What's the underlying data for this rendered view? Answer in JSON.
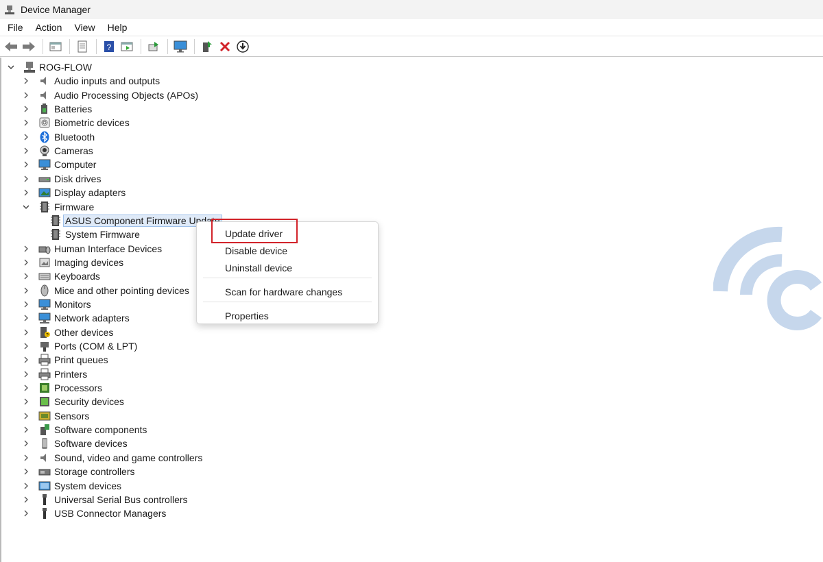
{
  "window": {
    "title": "Device Manager"
  },
  "menubar": {
    "items": [
      "File",
      "Action",
      "View",
      "Help"
    ]
  },
  "toolbar": {
    "icons": [
      "back-arrow-icon",
      "forward-arrow-icon",
      "show-hide-console-tree-icon",
      "properties-sheet-icon",
      "help-icon",
      "action-pane-icon",
      "scan-hardware-icon",
      "monitor-icon",
      "enable-device-icon",
      "uninstall-device-icon",
      "update-driver-icon"
    ]
  },
  "tree": {
    "root": "ROG-FLOW",
    "categories": [
      {
        "label": "Audio inputs and outputs",
        "icon": "speaker-icon",
        "expanded": false
      },
      {
        "label": "Audio Processing Objects (APOs)",
        "icon": "speaker-icon",
        "expanded": false
      },
      {
        "label": "Batteries",
        "icon": "battery-icon",
        "expanded": false
      },
      {
        "label": "Biometric devices",
        "icon": "fingerprint-icon",
        "expanded": false
      },
      {
        "label": "Bluetooth",
        "icon": "bluetooth-icon",
        "expanded": false
      },
      {
        "label": "Cameras",
        "icon": "camera-icon",
        "expanded": false
      },
      {
        "label": "Computer",
        "icon": "computer-icon",
        "expanded": false
      },
      {
        "label": "Disk drives",
        "icon": "disk-drive-icon",
        "expanded": false
      },
      {
        "label": "Display adapters",
        "icon": "display-adapter-icon",
        "expanded": false
      },
      {
        "label": "Firmware",
        "icon": "chip-icon",
        "expanded": true,
        "children": [
          {
            "label": "ASUS Component Firmware Update",
            "icon": "chip-icon",
            "selected": true
          },
          {
            "label": "System Firmware",
            "icon": "chip-icon",
            "selected": false
          }
        ]
      },
      {
        "label": "Human Interface Devices",
        "icon": "hid-icon",
        "expanded": false
      },
      {
        "label": "Imaging devices",
        "icon": "imaging-icon",
        "expanded": false
      },
      {
        "label": "Keyboards",
        "icon": "keyboard-icon",
        "expanded": false
      },
      {
        "label": "Mice and other pointing devices",
        "icon": "mouse-icon",
        "expanded": false
      },
      {
        "label": "Monitors",
        "icon": "monitor-icon",
        "expanded": false
      },
      {
        "label": "Network adapters",
        "icon": "network-icon",
        "expanded": false
      },
      {
        "label": "Other devices",
        "icon": "unknown-device-icon",
        "expanded": false
      },
      {
        "label": "Ports (COM & LPT)",
        "icon": "port-icon",
        "expanded": false
      },
      {
        "label": "Print queues",
        "icon": "printer-icon",
        "expanded": false
      },
      {
        "label": "Printers",
        "icon": "printer-icon",
        "expanded": false
      },
      {
        "label": "Processors",
        "icon": "processor-icon",
        "expanded": false
      },
      {
        "label": "Security devices",
        "icon": "security-icon",
        "expanded": false
      },
      {
        "label": "Sensors",
        "icon": "sensor-icon",
        "expanded": false
      },
      {
        "label": "Software components",
        "icon": "software-component-icon",
        "expanded": false
      },
      {
        "label": "Software devices",
        "icon": "software-device-icon",
        "expanded": false
      },
      {
        "label": "Sound, video and game controllers",
        "icon": "speaker-icon",
        "expanded": false
      },
      {
        "label": "Storage controllers",
        "icon": "storage-controller-icon",
        "expanded": false
      },
      {
        "label": "System devices",
        "icon": "system-device-icon",
        "expanded": false
      },
      {
        "label": "Universal Serial Bus controllers",
        "icon": "usb-icon",
        "expanded": false
      },
      {
        "label": "USB Connector Managers",
        "icon": "usb-icon",
        "expanded": false
      }
    ]
  },
  "context_menu": {
    "items": [
      "Update driver",
      "Disable device",
      "Uninstall device",
      "Scan for hardware changes",
      "Properties"
    ],
    "highlighted": "Update driver"
  },
  "colors": {
    "selection_bg": "#dfeaf8",
    "highlight_border": "#d2232a",
    "watermark": "#c6d7ec"
  }
}
